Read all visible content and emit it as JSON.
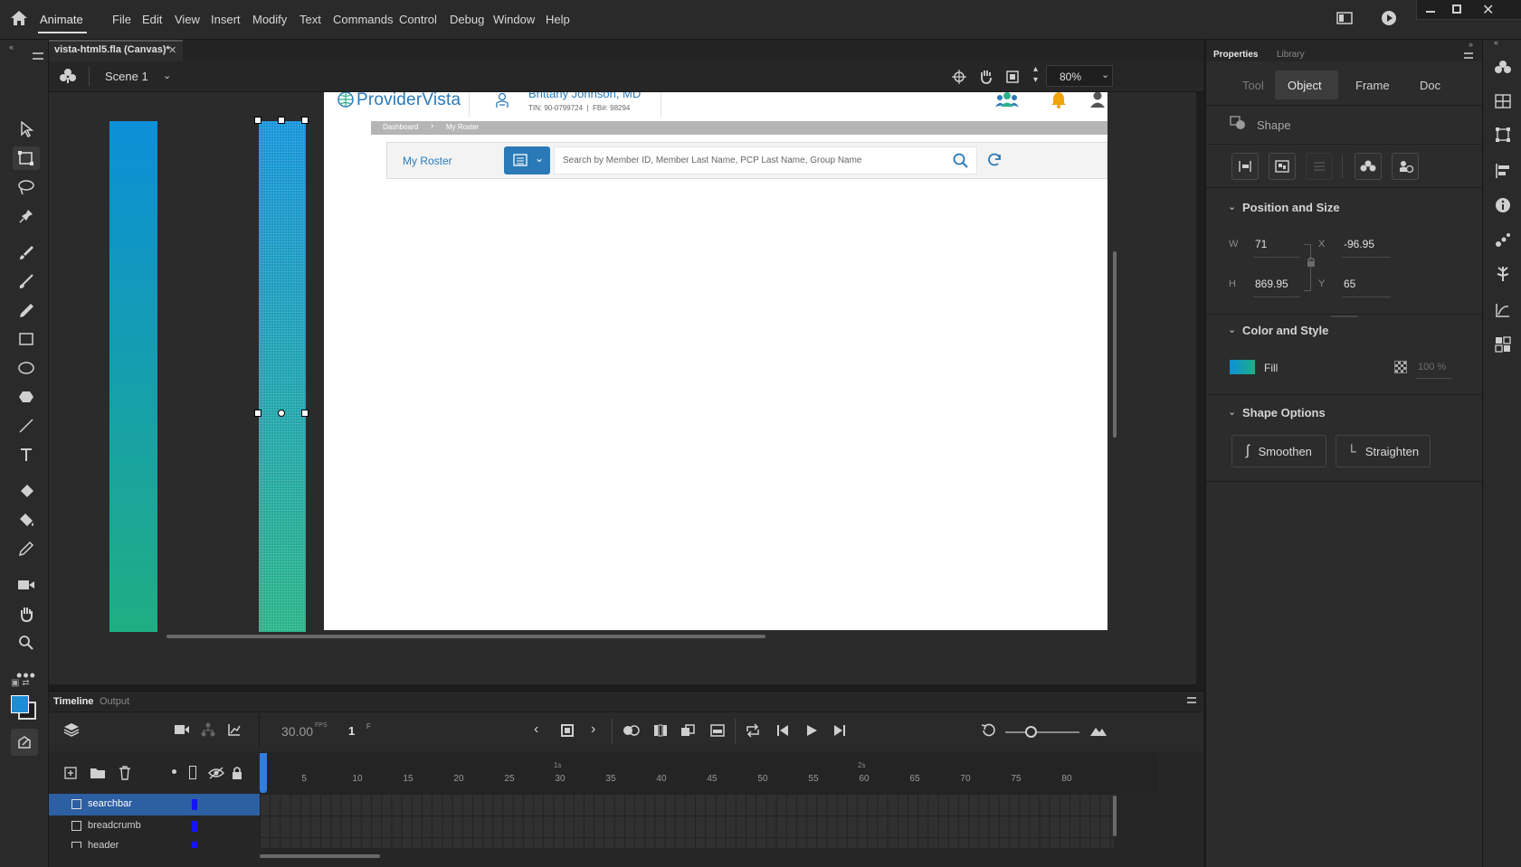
{
  "app": {
    "name": "Animate"
  },
  "menu": [
    "File",
    "Edit",
    "View",
    "Insert",
    "Modify",
    "Text",
    "Commands",
    "Control",
    "Debug",
    "Window",
    "Help"
  ],
  "document": {
    "tab_title": "vista-html5.fla (Canvas)*",
    "scene": "Scene 1",
    "zoom": "80%"
  },
  "stage": {
    "logo": "ProviderVista",
    "user_name": "Brittany Johnson, MD",
    "user_ids": "TIN: 90-0799724  |  FB#: 98294",
    "breadcrumb": [
      "Dashboard",
      "My Roster"
    ],
    "page_title": "My Roster",
    "search_placeholder": "Search by Member ID, Member Last Name, PCP Last Name, Group Name",
    "colors": {
      "brand": "#2a7ab8",
      "accent_teal": "#2bb08a",
      "bell": "#f0a30a"
    }
  },
  "properties": {
    "tabs": [
      "Properties",
      "Library"
    ],
    "subtabs": [
      "Tool",
      "Object",
      "Frame",
      "Doc"
    ],
    "active_subtab": "Object",
    "shape_label": "Shape",
    "position_size": {
      "title": "Position and Size",
      "w_label": "W",
      "w": "71",
      "h_label": "H",
      "h": "869.95",
      "x_label": "X",
      "x": "-96.95",
      "y_label": "Y",
      "y": "65"
    },
    "color_style": {
      "title": "Color and Style",
      "fill_label": "Fill",
      "opacity": "100 %"
    },
    "shape_options": {
      "title": "Shape Options",
      "smoothen": "Smoothen",
      "straighten": "Straighten"
    }
  },
  "timeline": {
    "tabs": [
      "Timeline",
      "Output"
    ],
    "fps": "30.00",
    "fps_unit": "FPS",
    "frame": "1",
    "frame_unit": "F",
    "ruler_seconds": [
      "1s",
      "2s"
    ],
    "ruler_frames": [
      "5",
      "10",
      "15",
      "20",
      "25",
      "30",
      "35",
      "40",
      "45",
      "50",
      "55",
      "60",
      "65",
      "70",
      "75",
      "80"
    ],
    "layers": [
      "searchbar",
      "breadcrumb",
      "header"
    ]
  }
}
